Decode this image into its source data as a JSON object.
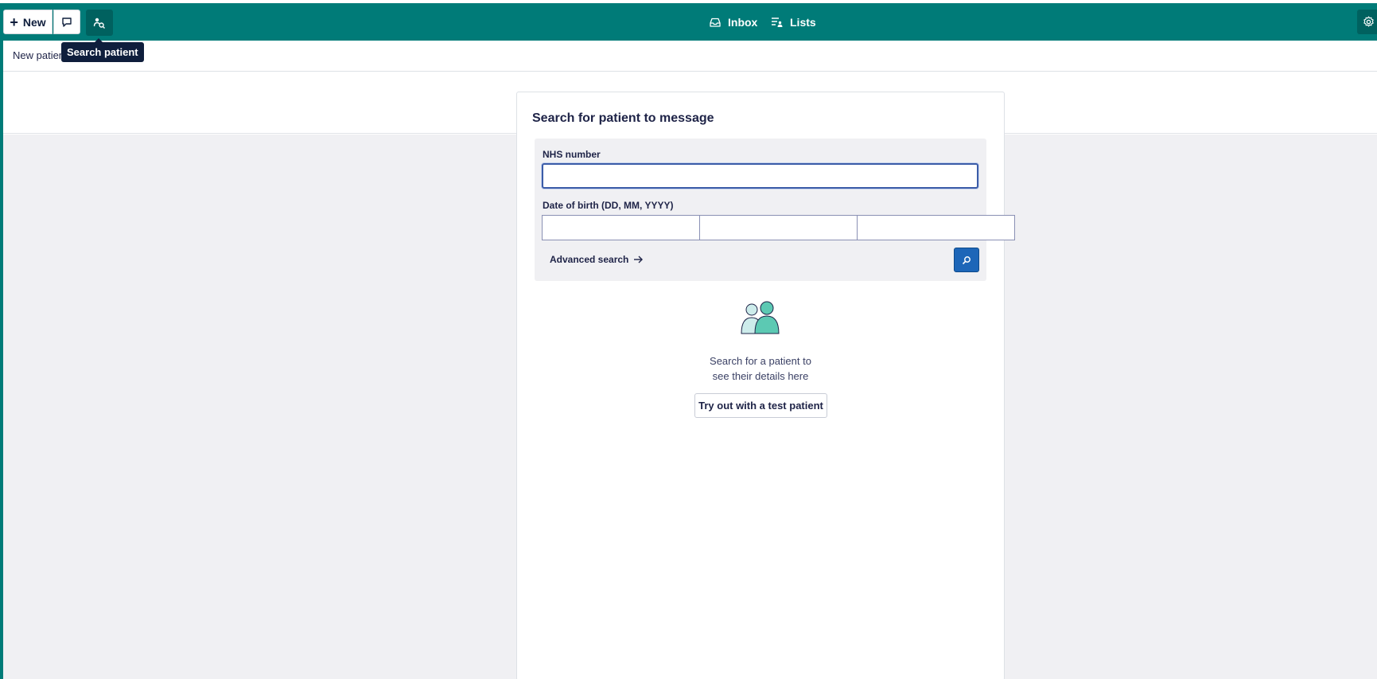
{
  "topbar": {
    "new_label": "New",
    "plus_glyph": "+",
    "nav": [
      {
        "label": "Inbox",
        "icon": "inbox-icon"
      },
      {
        "label": "Lists",
        "icon": "lists-icon"
      }
    ],
    "icons": [
      "message-icon",
      "search-patient-icon",
      "settings-icon"
    ],
    "colors": {
      "bar": "#007b78",
      "active_button": "#00615f"
    }
  },
  "tooltip": {
    "text": "Search patient"
  },
  "subbar": {
    "label": "New patient"
  },
  "panel": {
    "title": "Search for patient to message",
    "nhs_label": "NHS number",
    "nhs_value": "",
    "dob_label": "Date of birth (DD, MM, YYYY)",
    "dob_day": "",
    "dob_month": "",
    "dob_year": "",
    "advanced_label": "Advanced search",
    "search_button_color": "#1d66b8",
    "empty_line1": "Search for a patient to",
    "empty_line2": "see their details here",
    "test_patient_label": "Try out with a test patient"
  }
}
